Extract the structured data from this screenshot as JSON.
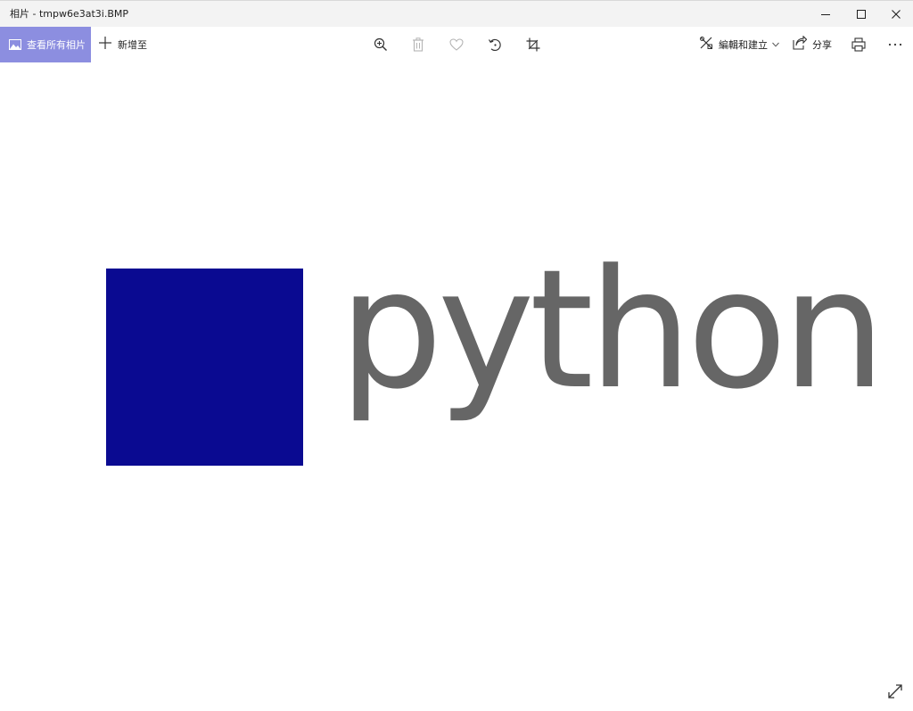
{
  "window": {
    "title": "相片 - tmpw6e3at3i.BMP"
  },
  "toolbar": {
    "view_all_label": "查看所有相片",
    "add_to_label": "新增至",
    "edit_create_label": "編輯和建立",
    "share_label": "分享"
  },
  "image": {
    "word": "python",
    "square_color": "#0a0a91",
    "word_color": "#666666"
  },
  "colors": {
    "accent": "#8c8ee0",
    "titlebar_bg": "#f3f3f3",
    "icon": "#333333",
    "icon_disabled": "#b4b4b4"
  },
  "icons": {
    "view_all": "photos-icon",
    "add_to": "plus-icon",
    "zoom": "zoom-in-icon",
    "delete": "trash-icon",
    "favorite": "heart-icon",
    "rotate": "rotate-icon",
    "crop": "crop-icon",
    "edit_create": "edit-create-icon",
    "share": "share-icon",
    "print": "print-icon",
    "more": "more-icon",
    "fullscreen": "fullscreen-icon"
  }
}
